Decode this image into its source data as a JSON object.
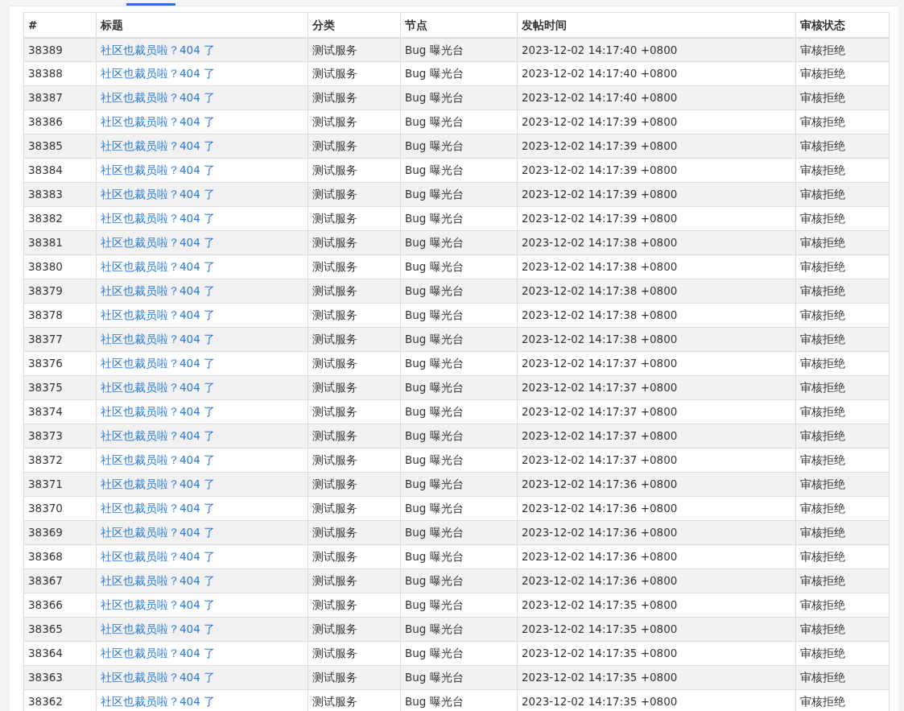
{
  "table": {
    "columns": [
      "#",
      "标题",
      "分类",
      "节点",
      "发帖时间",
      "审核状态"
    ],
    "rows": [
      {
        "id": "38389",
        "title": "社区也裁员啦？404 了",
        "category": "测试服务",
        "node": "Bug 曝光台",
        "time": "2023-12-02 14:17:40 +0800",
        "status": "审核拒绝"
      },
      {
        "id": "38388",
        "title": "社区也裁员啦？404 了",
        "category": "测试服务",
        "node": "Bug 曝光台",
        "time": "2023-12-02 14:17:40 +0800",
        "status": "审核拒绝"
      },
      {
        "id": "38387",
        "title": "社区也裁员啦？404 了",
        "category": "测试服务",
        "node": "Bug 曝光台",
        "time": "2023-12-02 14:17:40 +0800",
        "status": "审核拒绝"
      },
      {
        "id": "38386",
        "title": "社区也裁员啦？404 了",
        "category": "测试服务",
        "node": "Bug 曝光台",
        "time": "2023-12-02 14:17:39 +0800",
        "status": "审核拒绝"
      },
      {
        "id": "38385",
        "title": "社区也裁员啦？404 了",
        "category": "测试服务",
        "node": "Bug 曝光台",
        "time": "2023-12-02 14:17:39 +0800",
        "status": "审核拒绝"
      },
      {
        "id": "38384",
        "title": "社区也裁员啦？404 了",
        "category": "测试服务",
        "node": "Bug 曝光台",
        "time": "2023-12-02 14:17:39 +0800",
        "status": "审核拒绝"
      },
      {
        "id": "38383",
        "title": "社区也裁员啦？404 了",
        "category": "测试服务",
        "node": "Bug 曝光台",
        "time": "2023-12-02 14:17:39 +0800",
        "status": "审核拒绝"
      },
      {
        "id": "38382",
        "title": "社区也裁员啦？404 了",
        "category": "测试服务",
        "node": "Bug 曝光台",
        "time": "2023-12-02 14:17:39 +0800",
        "status": "审核拒绝"
      },
      {
        "id": "38381",
        "title": "社区也裁员啦？404 了",
        "category": "测试服务",
        "node": "Bug 曝光台",
        "time": "2023-12-02 14:17:38 +0800",
        "status": "审核拒绝"
      },
      {
        "id": "38380",
        "title": "社区也裁员啦？404 了",
        "category": "测试服务",
        "node": "Bug 曝光台",
        "time": "2023-12-02 14:17:38 +0800",
        "status": "审核拒绝"
      },
      {
        "id": "38379",
        "title": "社区也裁员啦？404 了",
        "category": "测试服务",
        "node": "Bug 曝光台",
        "time": "2023-12-02 14:17:38 +0800",
        "status": "审核拒绝"
      },
      {
        "id": "38378",
        "title": "社区也裁员啦？404 了",
        "category": "测试服务",
        "node": "Bug 曝光台",
        "time": "2023-12-02 14:17:38 +0800",
        "status": "审核拒绝"
      },
      {
        "id": "38377",
        "title": "社区也裁员啦？404 了",
        "category": "测试服务",
        "node": "Bug 曝光台",
        "time": "2023-12-02 14:17:38 +0800",
        "status": "审核拒绝"
      },
      {
        "id": "38376",
        "title": "社区也裁员啦？404 了",
        "category": "测试服务",
        "node": "Bug 曝光台",
        "time": "2023-12-02 14:17:37 +0800",
        "status": "审核拒绝"
      },
      {
        "id": "38375",
        "title": "社区也裁员啦？404 了",
        "category": "测试服务",
        "node": "Bug 曝光台",
        "time": "2023-12-02 14:17:37 +0800",
        "status": "审核拒绝"
      },
      {
        "id": "38374",
        "title": "社区也裁员啦？404 了",
        "category": "测试服务",
        "node": "Bug 曝光台",
        "time": "2023-12-02 14:17:37 +0800",
        "status": "审核拒绝"
      },
      {
        "id": "38373",
        "title": "社区也裁员啦？404 了",
        "category": "测试服务",
        "node": "Bug 曝光台",
        "time": "2023-12-02 14:17:37 +0800",
        "status": "审核拒绝"
      },
      {
        "id": "38372",
        "title": "社区也裁员啦？404 了",
        "category": "测试服务",
        "node": "Bug 曝光台",
        "time": "2023-12-02 14:17:37 +0800",
        "status": "审核拒绝"
      },
      {
        "id": "38371",
        "title": "社区也裁员啦？404 了",
        "category": "测试服务",
        "node": "Bug 曝光台",
        "time": "2023-12-02 14:17:36 +0800",
        "status": "审核拒绝"
      },
      {
        "id": "38370",
        "title": "社区也裁员啦？404 了",
        "category": "测试服务",
        "node": "Bug 曝光台",
        "time": "2023-12-02 14:17:36 +0800",
        "status": "审核拒绝"
      },
      {
        "id": "38369",
        "title": "社区也裁员啦？404 了",
        "category": "测试服务",
        "node": "Bug 曝光台",
        "time": "2023-12-02 14:17:36 +0800",
        "status": "审核拒绝"
      },
      {
        "id": "38368",
        "title": "社区也裁员啦？404 了",
        "category": "测试服务",
        "node": "Bug 曝光台",
        "time": "2023-12-02 14:17:36 +0800",
        "status": "审核拒绝"
      },
      {
        "id": "38367",
        "title": "社区也裁员啦？404 了",
        "category": "测试服务",
        "node": "Bug 曝光台",
        "time": "2023-12-02 14:17:36 +0800",
        "status": "审核拒绝"
      },
      {
        "id": "38366",
        "title": "社区也裁员啦？404 了",
        "category": "测试服务",
        "node": "Bug 曝光台",
        "time": "2023-12-02 14:17:35 +0800",
        "status": "审核拒绝"
      },
      {
        "id": "38365",
        "title": "社区也裁员啦？404 了",
        "category": "测试服务",
        "node": "Bug 曝光台",
        "time": "2023-12-02 14:17:35 +0800",
        "status": "审核拒绝"
      },
      {
        "id": "38364",
        "title": "社区也裁员啦？404 了",
        "category": "测试服务",
        "node": "Bug 曝光台",
        "time": "2023-12-02 14:17:35 +0800",
        "status": "审核拒绝"
      },
      {
        "id": "38363",
        "title": "社区也裁员啦？404 了",
        "category": "测试服务",
        "node": "Bug 曝光台",
        "time": "2023-12-02 14:17:35 +0800",
        "status": "审核拒绝"
      },
      {
        "id": "38362",
        "title": "社区也裁员啦？404 了",
        "category": "测试服务",
        "node": "Bug 曝光台",
        "time": "2023-12-02 14:17:35 +0800",
        "status": "审核拒绝"
      }
    ]
  }
}
